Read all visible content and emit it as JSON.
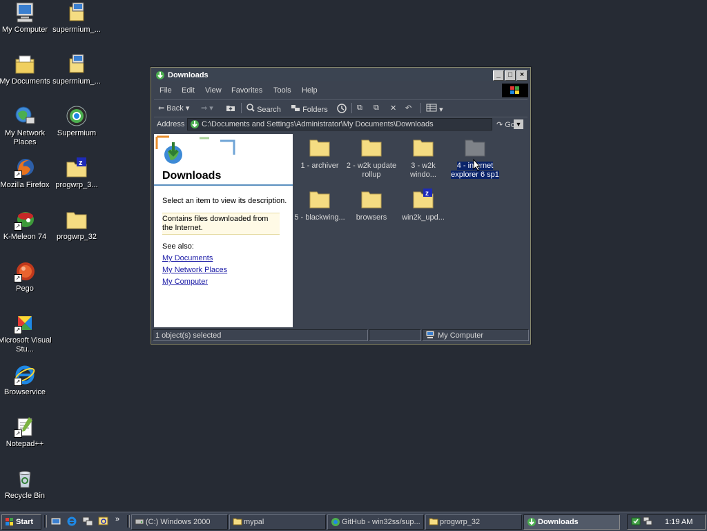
{
  "desktop": {
    "icons": [
      {
        "label": "My Computer",
        "icon": "computer-icon"
      },
      {
        "label": "supermium_...",
        "icon": "installer-icon"
      },
      {
        "label": "My Documents",
        "icon": "documents-folder-icon"
      },
      {
        "label": "supermium_...",
        "icon": "installer-icon"
      },
      {
        "label": "My Network Places",
        "icon": "network-icon"
      },
      {
        "label": "Supermium",
        "icon": "supermium-icon"
      },
      {
        "label": "Mozilla Firefox",
        "icon": "firefox-icon"
      },
      {
        "label": "progwrp_3...",
        "icon": "zip-folder-icon"
      },
      {
        "label": "K-Meleon 74",
        "icon": "kmeleon-icon"
      },
      {
        "label": "progwrp_32",
        "icon": "folder-icon"
      },
      {
        "label": "Pego",
        "icon": "pego-icon"
      },
      {
        "label": "Microsoft Visual Stu...",
        "icon": "visual-studio-icon"
      },
      {
        "label": "Browservice",
        "icon": "internet-explorer-icon"
      },
      {
        "label": "Notepad++",
        "icon": "notepadpp-icon"
      },
      {
        "label": "Recycle Bin",
        "icon": "recycle-bin-icon"
      }
    ]
  },
  "window": {
    "title": "Downloads",
    "menu": [
      "File",
      "Edit",
      "View",
      "Favorites",
      "Tools",
      "Help"
    ],
    "toolbar": {
      "back": "Back",
      "search": "Search",
      "folders": "Folders"
    },
    "address": {
      "label": "Address",
      "value": "C:\\Documents and Settings\\Administrator\\My Documents\\Downloads",
      "go": "Go"
    },
    "info_pane": {
      "title": "Downloads",
      "select_hint": "Select an item to view its description.",
      "description": "Contains files downloaded from the Internet.",
      "see_also": "See also:",
      "links": [
        "My Documents",
        "My Network Places",
        "My Computer"
      ]
    },
    "files": [
      {
        "label": "1 - archiver",
        "icon": "folder-icon",
        "selected": false
      },
      {
        "label": "2 - w2k update rollup",
        "icon": "folder-icon",
        "selected": false
      },
      {
        "label": "3 - w2k windo...",
        "icon": "folder-icon",
        "selected": false
      },
      {
        "label": "4 - internet explorer 6 sp1",
        "icon": "folder-icon",
        "selected": true
      },
      {
        "label": "5 - blackwing...",
        "icon": "folder-icon",
        "selected": false
      },
      {
        "label": "browsers",
        "icon": "folder-icon",
        "selected": false
      },
      {
        "label": "win2k_upd...",
        "icon": "zip-folder-icon",
        "selected": false
      }
    ],
    "status": {
      "selection": "1 object(s) selected",
      "zone": "My Computer"
    }
  },
  "taskbar": {
    "start": "Start",
    "tasks": [
      {
        "label": "(C:) Windows 2000",
        "icon": "drive-icon",
        "active": false
      },
      {
        "label": "mypal",
        "icon": "folder-icon",
        "active": false
      },
      {
        "label": "GitHub - win32ss/sup...",
        "icon": "supermium-icon",
        "active": false
      },
      {
        "label": "progwrp_32",
        "icon": "folder-icon",
        "active": false
      },
      {
        "label": "Downloads",
        "icon": "downloads-icon",
        "active": true
      }
    ],
    "clock": "1:19 AM"
  },
  "colors": {
    "desktop": "#262b34",
    "window_bg": "#3c4350",
    "selection": "#0a246a",
    "folder": "#f5dc82",
    "link": "#1a1aa6"
  }
}
